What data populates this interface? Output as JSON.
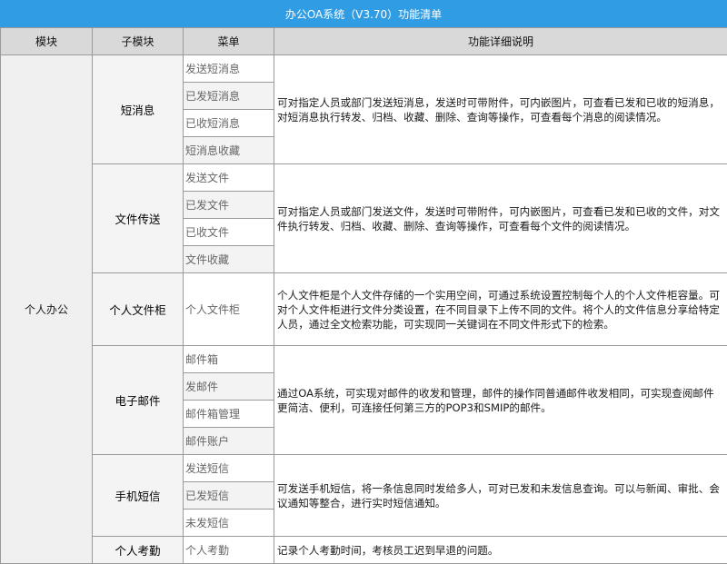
{
  "title": "办公OA系统（V3.70）功能清单",
  "headers": {
    "module": "模块",
    "submodule": "子模块",
    "menu": "菜单",
    "desc": "功能详细说明"
  },
  "module_name": "个人办公",
  "groups": [
    {
      "name": "短消息",
      "menus": [
        "发送短消息",
        "已发短消息",
        "已收短消息",
        "短消息收藏"
      ],
      "desc": "可对指定人员或部门发送短消息，发送时可带附件，可内嵌图片，可查看已发和已收的短消息，对短消息执行转发、归档、收藏、删除、查询等操作，可查看每个消息的阅读情况。"
    },
    {
      "name": "文件传送",
      "menus": [
        "发送文件",
        "已发文件",
        "已收文件",
        "文件收藏"
      ],
      "desc": "可对指定人员或部门发送文件，发送时可带附件，可内嵌图片，可查看已发和已收的文件，对文件执行转发、归档、收藏、删除、查询等操作，可查看每个文件的阅读情况。"
    },
    {
      "name": "个人文件柜",
      "menus": [
        "个人文件柜"
      ],
      "desc": "个人文件柜是个人文件存储的一个实用空间，可通过系统设置控制每个人的个人文件柜容量。可对个人文件柜进行文件分类设置，在不同目录下上传不同的文件。将个人的文件信息分享给特定人员，通过全文检索功能，可实现同一关键词在不同文件形式下的检索。"
    },
    {
      "name": "电子邮件",
      "menus": [
        "邮件箱",
        "发邮件",
        "邮件箱管理",
        "邮件账户"
      ],
      "desc": "通过OA系统，可实现对邮件的收发和管理，邮件的操作同普通邮件收发相同，可实现查阅邮件更简洁、便利，可连接任何第三方的POP3和SMIP的邮件。"
    },
    {
      "name": "手机短信",
      "menus": [
        "发送短信",
        "已发短信",
        "未发短信"
      ],
      "desc": "可发送手机短信，将一条信息同时发给多人，可对已发和未发信息查询。可以与新闻、审批、会议通知等整合，进行实时短信通知。"
    },
    {
      "name": "个人考勤",
      "menus": [
        "个人考勤"
      ],
      "desc": "记录个人考勤时间，考核员工迟到早退的问题。"
    }
  ]
}
